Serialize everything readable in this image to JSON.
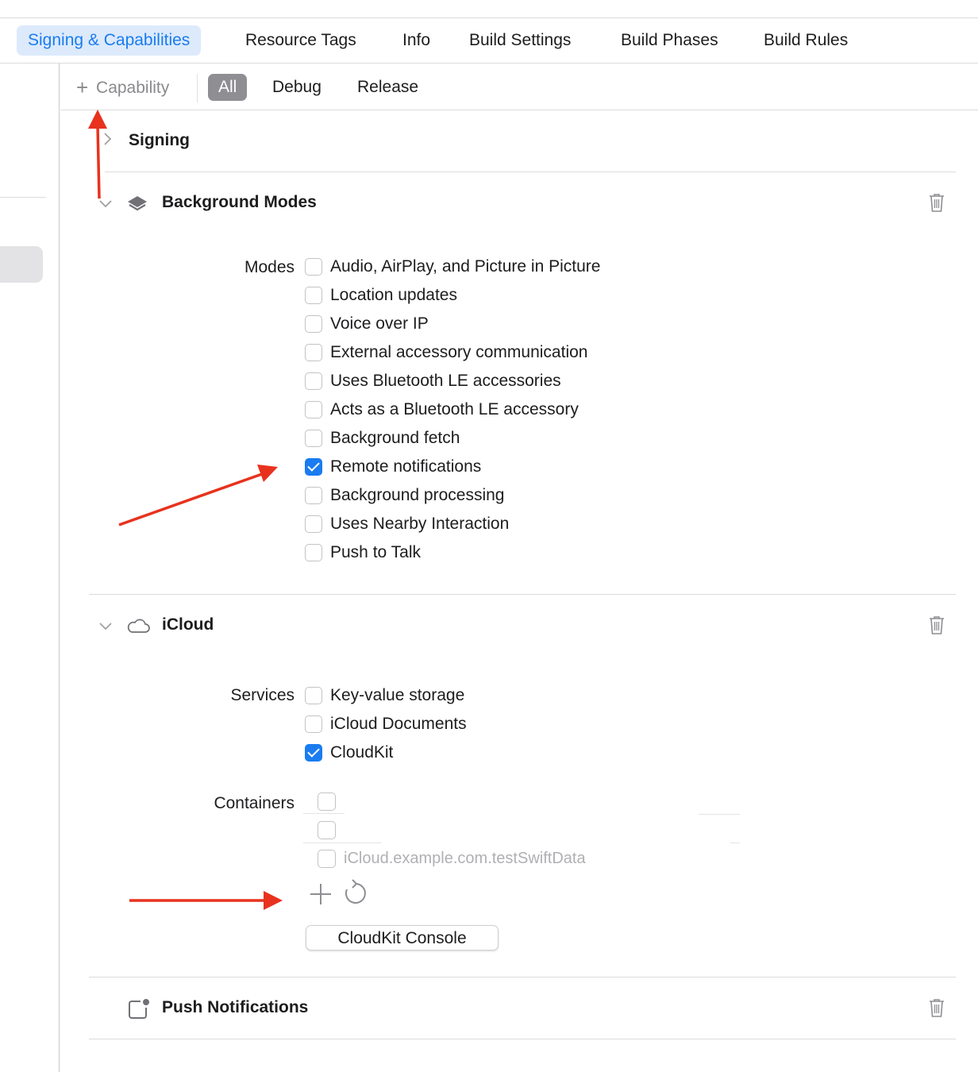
{
  "tabs": [
    {
      "label": "Signing & Capabilities",
      "active": true
    },
    {
      "label": "Resource Tags"
    },
    {
      "label": "Info"
    },
    {
      "label": "Build Settings"
    },
    {
      "label": "Build Phases"
    },
    {
      "label": "Build Rules"
    }
  ],
  "filter_bar": {
    "add_capability": "Capability",
    "configs": [
      "All",
      "Debug",
      "Release"
    ],
    "selected": "All"
  },
  "signing": {
    "title": "Signing",
    "expanded": false
  },
  "background_modes": {
    "title": "Background Modes",
    "modes_label": "Modes",
    "options": [
      {
        "label": "Audio, AirPlay, and Picture in Picture",
        "checked": false
      },
      {
        "label": "Location updates",
        "checked": false
      },
      {
        "label": "Voice over IP",
        "checked": false
      },
      {
        "label": "External accessory communication",
        "checked": false
      },
      {
        "label": "Uses Bluetooth LE accessories",
        "checked": false
      },
      {
        "label": "Acts as a Bluetooth LE accessory",
        "checked": false
      },
      {
        "label": "Background fetch",
        "checked": false
      },
      {
        "label": "Remote notifications",
        "checked": true
      },
      {
        "label": "Background processing",
        "checked": false
      },
      {
        "label": "Uses Nearby Interaction",
        "checked": false
      },
      {
        "label": "Push to Talk",
        "checked": false
      }
    ]
  },
  "icloud": {
    "title": "iCloud",
    "services_label": "Services",
    "services": [
      {
        "label": "Key-value storage",
        "checked": false
      },
      {
        "label": "iCloud Documents",
        "checked": false
      },
      {
        "label": "CloudKit",
        "checked": true
      }
    ],
    "containers_label": "Containers",
    "containers": [
      {
        "label": "",
        "checked": false
      },
      {
        "label": "",
        "checked": false
      },
      {
        "label": "iCloud.example.com.testSwiftData",
        "checked": false
      }
    ],
    "console_button": "CloudKit Console"
  },
  "push_notifications": {
    "title": "Push Notifications"
  },
  "colors": {
    "accent": "#1a7cf0",
    "annotation": "#e8321e"
  }
}
